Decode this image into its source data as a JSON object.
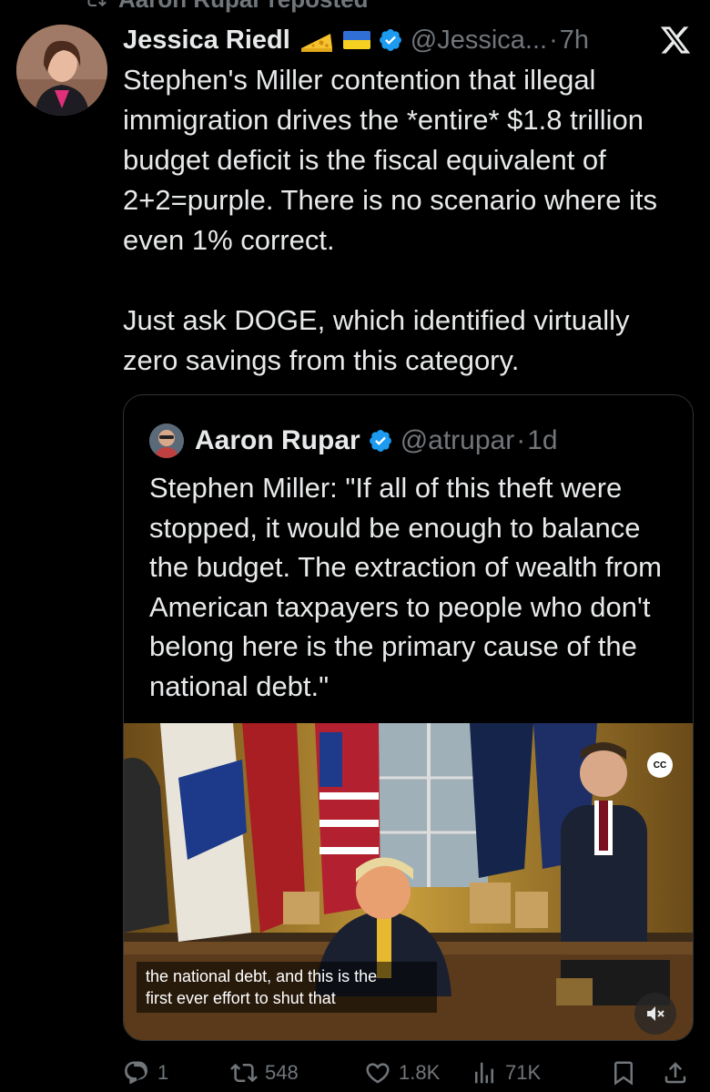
{
  "repost": {
    "text": "Aaron Rupar reposted"
  },
  "tweet": {
    "author_name": "Jessica Riedl",
    "handle": "@Jessica...",
    "separator": "·",
    "time": "7h",
    "text": "Stephen's Miller contention that illegal immigration drives the *entire* $1.8 trillion budget deficit is the fiscal equivalent of 2+2=purple. There is no scenario where its even 1% correct.\n\nJust ask DOGE, which identified virtually zero savings from this category."
  },
  "quoted": {
    "author_name": "Aaron Rupar",
    "handle": "@atrupar",
    "separator": "·",
    "time": "1d",
    "text": "Stephen Miller: \"If all of this theft were stopped, it would be enough to balance the budget. The extraction of wealth from American taxpayers to people who don't belong here is the primary cause of the national debt.\"",
    "video": {
      "cc_label": "CC",
      "caption_line1": "the national debt, and this is the",
      "caption_line2": "first ever effort to shut that"
    }
  },
  "actions": {
    "replies": "1",
    "reposts": "548",
    "likes": "1.8K",
    "views": "71K"
  },
  "colors": {
    "accent_blue": "#1d9bf0",
    "muted": "#71767b",
    "text": "#e7e9ea",
    "background": "#000000"
  },
  "icons": [
    "repost-icon",
    "cheese-emoji-icon",
    "ukraine-flag-icon",
    "verified-badge-icon",
    "x-logo-icon",
    "cc-icon",
    "mute-icon",
    "reply-icon",
    "retweet-icon",
    "like-icon",
    "views-icon",
    "bookmark-icon",
    "share-icon"
  ]
}
